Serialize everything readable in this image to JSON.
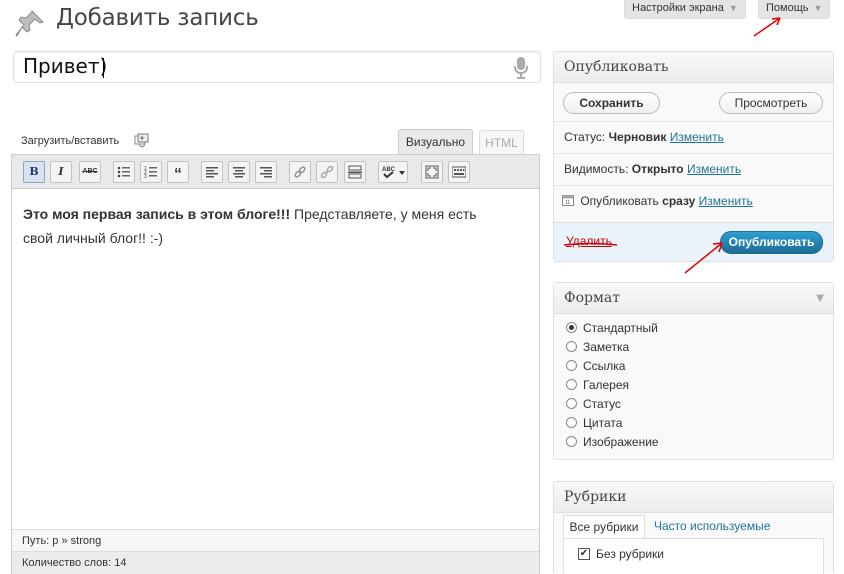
{
  "header": {
    "title": "Добавить запись",
    "screen_options_label": "Настройки экрана",
    "help_label": "Помощь"
  },
  "post": {
    "title_value": "Привет)"
  },
  "editor": {
    "upload_label": "Загрузить/вставить",
    "tab_visual": "Визуально",
    "tab_html": "HTML",
    "content_bold": "Это моя первая запись в этом блоге!!!",
    "content_rest_line1": " Представляете, у меня есть",
    "content_line2": "свой личный блог!! :-)",
    "path_label": "Путь: p » strong",
    "word_count_label": "Количество слов: 14"
  },
  "publish": {
    "title": "Опубликовать",
    "save_label": "Сохранить",
    "preview_label": "Просмотреть",
    "status_label": "Статус:",
    "status_value": "Черновик",
    "visibility_label": "Видимость:",
    "visibility_value": "Открыто",
    "schedule_label": "Опубликовать",
    "schedule_value": "сразу",
    "edit_link": "Изменить",
    "delete_label": "Удалить",
    "publish_label": "Опубликовать"
  },
  "format": {
    "title": "Формат",
    "selected": "Стандартный",
    "options": [
      "Стандартный",
      "Заметка",
      "Ссылка",
      "Галерея",
      "Статус",
      "Цитата",
      "Изображение"
    ]
  },
  "categories": {
    "title": "Рубрики",
    "tab_all": "Все рубрики",
    "tab_popular": "Часто используемые",
    "items": [
      {
        "label": "Без рубрики",
        "checked": true
      }
    ]
  },
  "colors": {
    "link": "#21759b",
    "publish_button": "#2384b5",
    "delete": "#bc0b0b",
    "annotation_arrow": "#e00000"
  }
}
